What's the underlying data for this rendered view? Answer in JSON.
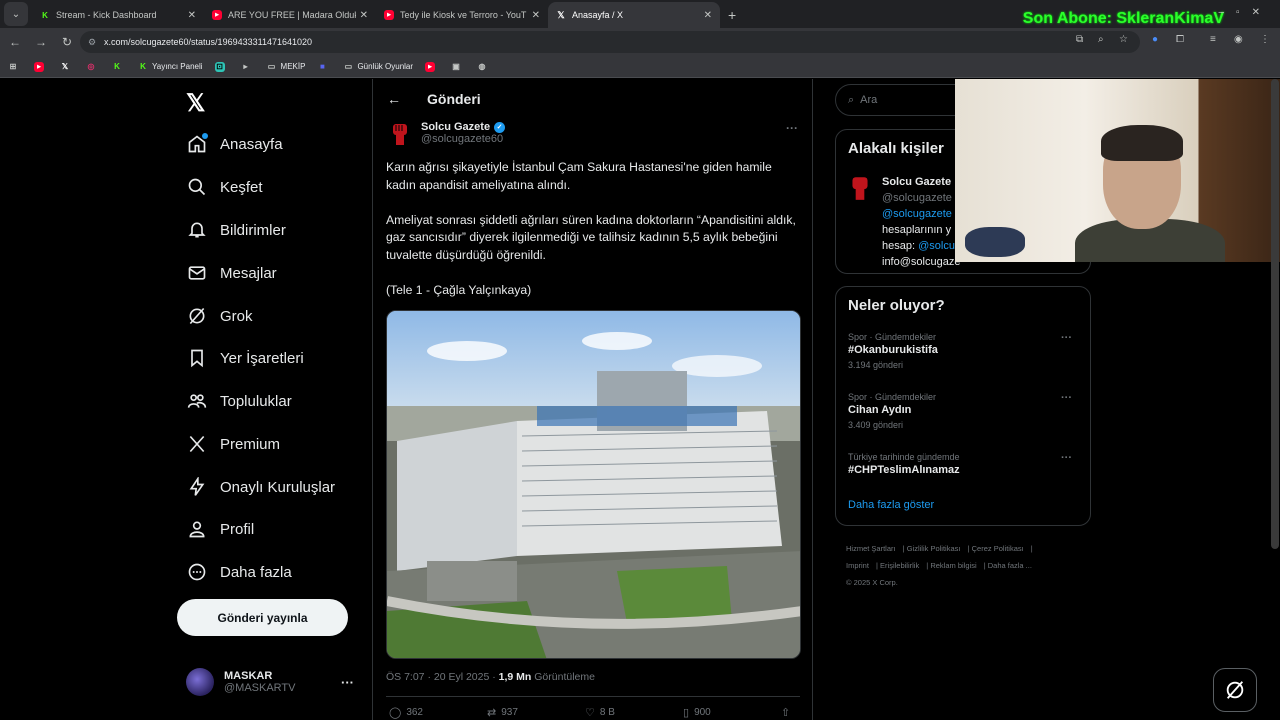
{
  "browser": {
    "tabs": [
      {
        "label": "Stream - Kick Dashboard",
        "icon": "kick-icon",
        "active": false
      },
      {
        "label": "ARE YOU FREE | Madara Olduk",
        "icon": "youtube-icon",
        "active": false
      },
      {
        "label": "Tedy ile Kiosk ve Terroro - YouT",
        "icon": "youtube-icon",
        "active": false
      },
      {
        "label": "Anasayfa / X",
        "icon": "x-icon",
        "active": true
      }
    ],
    "url": "x.com/solcugazete60/status/1969433311471641020",
    "bookmarks": [
      "",
      "",
      "",
      "Yayıncı Paneli",
      "",
      "",
      "MEKİP",
      "",
      "Günlük Oyunlar",
      "",
      "",
      ""
    ],
    "bookmark_labels": {
      "yayinci": "Yayıncı Paneli",
      "mekip": "MEKİP",
      "gunluk": "Günlük Oyunlar"
    }
  },
  "overlay": {
    "streamer_text": "Son Abone: SkleranKimaV"
  },
  "nav": {
    "items": [
      {
        "label": "Anasayfa",
        "icon": "home-icon"
      },
      {
        "label": "Keşfet",
        "icon": "search-icon"
      },
      {
        "label": "Bildirimler",
        "icon": "bell-icon"
      },
      {
        "label": "Mesajlar",
        "icon": "mail-icon"
      },
      {
        "label": "Grok",
        "icon": "grok-icon"
      },
      {
        "label": "Yer İşaretleri",
        "icon": "bookmark-icon"
      },
      {
        "label": "Topluluklar",
        "icon": "communities-icon"
      },
      {
        "label": "Premium",
        "icon": "x-icon"
      },
      {
        "label": "Onaylı Kuruluşlar",
        "icon": "lightning-icon"
      },
      {
        "label": "Profil",
        "icon": "person-icon"
      },
      {
        "label": "Daha fazla",
        "icon": "more-circle-icon"
      }
    ],
    "post_button": "Gönderi yayınla",
    "profile": {
      "name": "MASKAR",
      "handle": "@MASKARTV"
    }
  },
  "main": {
    "header_title": "Gönderi",
    "author": {
      "name": "Solcu Gazete",
      "handle": "@solcugazete60"
    },
    "tweet_paragraphs": [
      "Karın ağrısı şikayetiyle İstanbul Çam Sakura Hastanesi'ne giden hamile kadın apandisit ameliyatına alındı.",
      "Ameliyat sonrası şiddetli ağrıları süren kadına doktorların “Apandisitini aldık, gaz sancısıdır” diyerek ilgilenmediği ve talihsiz kadının 5,5 aylık bebeğini tuvalette düşürdüğü öğrenildi.",
      "(Tele 1 - Çağla Yalçınkaya)"
    ],
    "timestamp": "ÖS 7:07 · 20 Eyl 2025 ·",
    "views_count": "1,9 Mn",
    "views_label": "Görüntüleme",
    "actions": {
      "replies": "362",
      "reposts": "937",
      "likes": "8 B",
      "bookmarks": "900"
    }
  },
  "right": {
    "search_placeholder": "Ara",
    "related_title": "Alakalı kişiler",
    "related": {
      "name": "Solcu Gazete",
      "handle": "@solcugazete",
      "bio_link": "@solcugazete",
      "bio_1": "hesaplarının y",
      "bio_2": "hesap: ",
      "bio_2_link": "@solcu",
      "bio_3": "info@solcugaze"
    },
    "trends_title": "Neler oluyor?",
    "trends": [
      {
        "category": "Spor · Gündemdekiler",
        "name": "#Okanburukistifa",
        "count": "3.194 gönderi"
      },
      {
        "category": "Spor · Gündemdekiler",
        "name": "Cihan Aydın",
        "count": "3.409 gönderi"
      },
      {
        "category": "Türkiye tarihinde gündemde",
        "name": "#CHPTeslimAlınamaz",
        "count": ""
      }
    ],
    "show_more": "Daha fazla göster",
    "footer": [
      "Hizmet Şartları",
      "Gizlilik Politikası",
      "Çerez Politikası",
      "Imprint",
      "Erişilebilirlik",
      "Reklam bilgisi",
      "Daha fazla ...",
      "© 2025 X Corp."
    ]
  },
  "colors": {
    "accent": "#1d9bf0",
    "overlay_green": "#2bff2b",
    "kick_green": "#53fc18"
  }
}
